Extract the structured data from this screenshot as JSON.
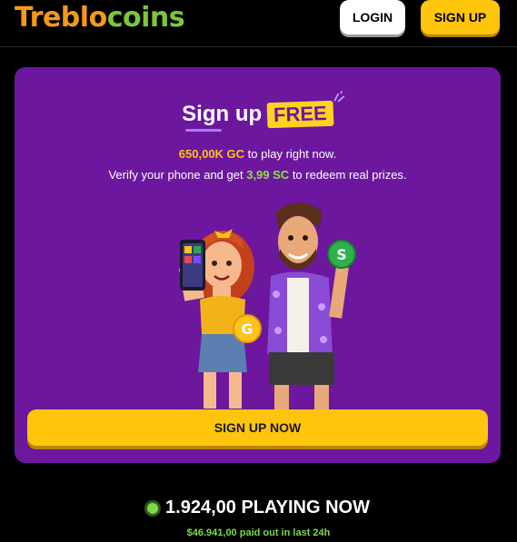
{
  "header": {
    "logo_part1": "Treblo",
    "logo_part2": "coins",
    "login_label": "LOGIN",
    "signup_label": "SIGN UP"
  },
  "promo": {
    "title": "Sign up",
    "badge": "FREE",
    "gc_amount": "650,00K GC",
    "gc_text": " to play right now.",
    "verify_text": "Verify your phone and get ",
    "sc_amount": "3,99 SC",
    "sc_text": " to redeem real prizes.",
    "coin_g": "G",
    "coin_s": "S",
    "cta_label": "SIGN UP NOW"
  },
  "stats": {
    "playing": "1.924,00 PLAYING NOW",
    "paid_out": "$46.941,00 paid out in last 24h"
  },
  "colors": {
    "card_bg": "#6c179d",
    "accent_yellow": "#ffc40c",
    "logo_orange": "#f39a17",
    "logo_green": "#7cc63a",
    "status_green": "#7fd84a"
  }
}
